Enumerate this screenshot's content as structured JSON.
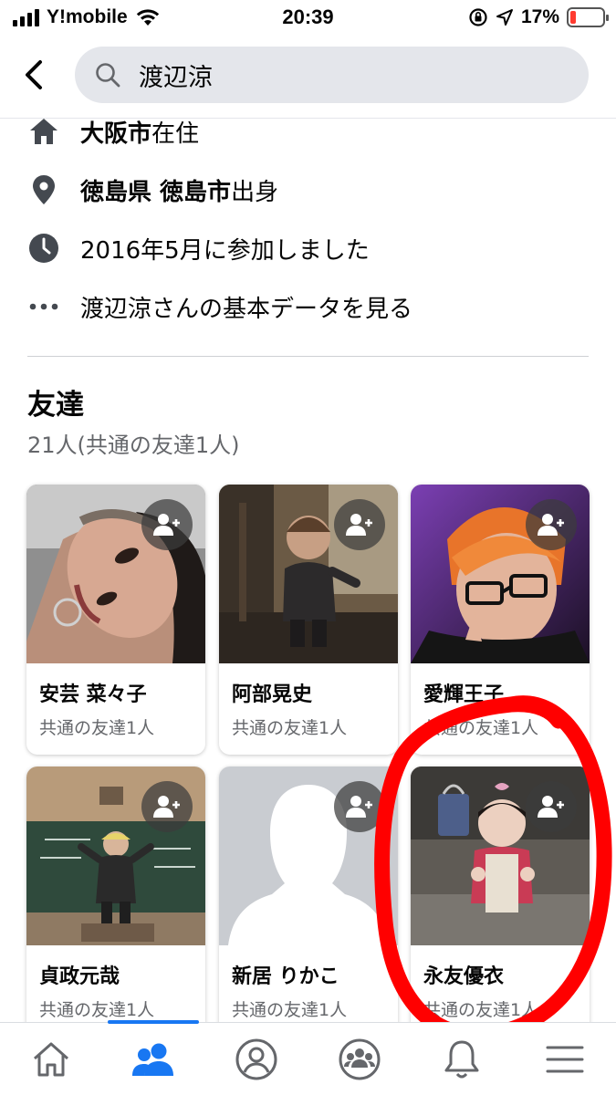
{
  "status_bar": {
    "carrier": "Y!mobile",
    "time": "20:39",
    "battery_percent": "17%",
    "battery_level": 0.17
  },
  "search": {
    "query": "渡辺涼"
  },
  "profile_info": {
    "residence_bold": "大阪市",
    "residence_suffix": "在住",
    "hometown_bold": "徳島県 徳島市",
    "hometown_suffix": "出身",
    "joined": "2016年5月に参加しました",
    "about_link": "渡辺涼さんの基本データを見る"
  },
  "friends": {
    "title": "友達",
    "count": "21人(共通の友達1人)",
    "cards": [
      {
        "name": "安芸 菜々子",
        "mutual": "共通の友達1人"
      },
      {
        "name": "阿部晃史",
        "mutual": "共通の友達1人"
      },
      {
        "name": "愛輝王子",
        "mutual": "共通の友達1人"
      },
      {
        "name": "貞政元哉",
        "mutual": "共通の友達1人"
      },
      {
        "name": "新居 りかこ",
        "mutual": "共通の友達1人"
      },
      {
        "name": "永友優衣",
        "mutual": "共通の友達1人"
      }
    ]
  },
  "nav": {
    "active_tab": "friends",
    "tabs": [
      "home",
      "friends",
      "profile",
      "groups",
      "notifications",
      "menu"
    ]
  },
  "colors": {
    "accent": "#1877f2",
    "annotation": "#ff0000",
    "secondary_text": "#65676b"
  }
}
